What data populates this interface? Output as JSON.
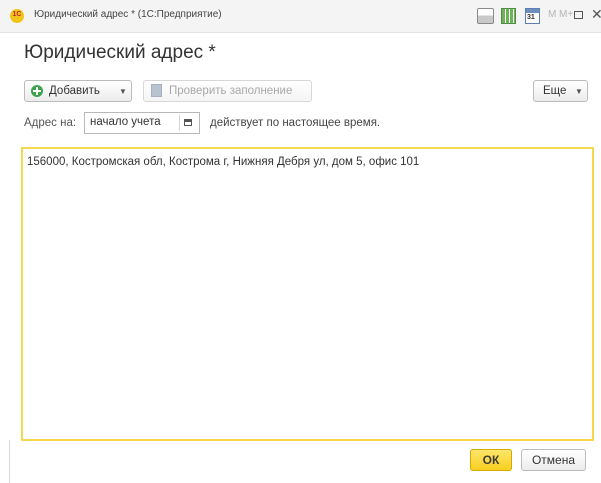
{
  "window": {
    "title": "Юридический адрес * (1С:Предприятие)",
    "toolbar_icons": [
      "print-icon",
      "table-icon",
      "calendar-icon"
    ],
    "calendar_icon_text": "31",
    "memory_buttons": [
      "M",
      "M+",
      "M-"
    ]
  },
  "form": {
    "title": "Юридический адрес *",
    "buttons": {
      "add": "Добавить",
      "check": "Проверить заполнение",
      "more": "Еще"
    },
    "address_on_label": "Адрес на:",
    "date_value": "начало учета",
    "valid_text": "действует по настоящее время.",
    "address_text": "156000, Костромская обл, Кострома г, Нижняя Дебря ул, дом 5, офис 101",
    "ok_label": "ОК",
    "cancel_label": "Отмена"
  },
  "colors": {
    "accent_yellow": "#f7cf1f",
    "focus_border": "#f5d84e",
    "add_icon_green": "#3fa34d"
  }
}
